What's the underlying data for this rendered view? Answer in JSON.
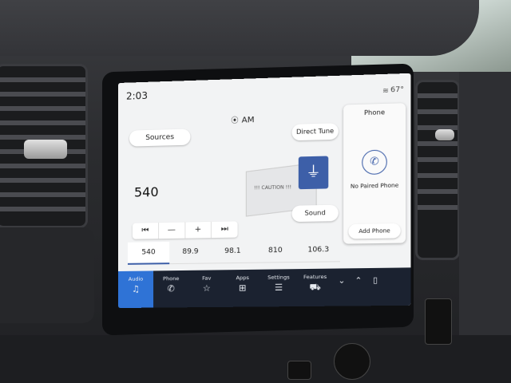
{
  "status": {
    "time": "2:03",
    "temperature": "67°"
  },
  "audio": {
    "band": "AM",
    "current_frequency": "540",
    "sources_label": "Sources",
    "direct_tune_label": "Direct Tune",
    "sound_label": "Sound",
    "art_text": "!!! CAUTION !!!",
    "controls": [
      "⏮",
      "—",
      "+",
      "⏭"
    ],
    "presets": [
      "540",
      "89.9",
      "98.1",
      "810",
      "106.3"
    ],
    "active_preset_index": 0
  },
  "phone": {
    "title": "Phone",
    "status_text": "No Paired Phone",
    "add_label": "Add Phone"
  },
  "dock": {
    "items": [
      {
        "label": "Audio",
        "icon": "music-note-icon"
      },
      {
        "label": "Phone",
        "icon": "phone-icon"
      },
      {
        "label": "Fav",
        "icon": "star-icon"
      },
      {
        "label": "Apps",
        "icon": "apps-grid-icon"
      },
      {
        "label": "Settings",
        "icon": "settings-sliders-icon"
      },
      {
        "label": "Features",
        "icon": "car-features-icon"
      }
    ],
    "active_index": 0
  },
  "colors": {
    "accent": "#2f73d6",
    "dock_bg": "#1b2230",
    "tile_blue": "#3d5fa8"
  }
}
